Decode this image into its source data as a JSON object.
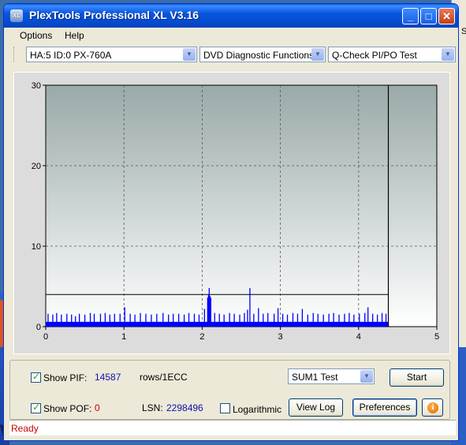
{
  "desktop": {
    "text": "ws",
    "side_label": "S"
  },
  "window": {
    "title": "PlexTools Professional XL V3.16",
    "icon_text": "XL",
    "minimize": "_",
    "maximize": "□",
    "close": "✕"
  },
  "menu": {
    "options": "Options",
    "help": "Help"
  },
  "toolbar": {
    "drive": "HA:5 ID:0  PX-760A",
    "function": "DVD Diagnostic Functions",
    "test": "Q-Check PI/PO Test",
    "dropdown_arrow": "▼"
  },
  "chart_data": {
    "type": "bar",
    "title": "",
    "xlabel": "",
    "ylabel": "",
    "xlim": [
      0,
      5
    ],
    "ylim": [
      0,
      30
    ],
    "x_ticks": [
      "0",
      "1",
      "2",
      "3",
      "4",
      "5"
    ],
    "y_ticks": [
      "0",
      "10",
      "20",
      "30"
    ],
    "grid": true,
    "threshold_line": 4,
    "end_marker_x": 4.38,
    "series": [
      {
        "color": "#0000ff",
        "baseline": 0.6,
        "data_end_x": 4.38,
        "spikes": [
          [
            0.03,
            1.6
          ],
          [
            0.09,
            1.5
          ],
          [
            0.14,
            1.7
          ],
          [
            0.2,
            1.5
          ],
          [
            0.27,
            1.6
          ],
          [
            0.33,
            1.5
          ],
          [
            0.38,
            1.3
          ],
          [
            0.43,
            1.6
          ],
          [
            0.5,
            1.5
          ],
          [
            0.57,
            1.7
          ],
          [
            0.62,
            1.6
          ],
          [
            0.7,
            1.6
          ],
          [
            0.76,
            1.7
          ],
          [
            0.82,
            1.5
          ],
          [
            0.88,
            1.6
          ],
          [
            0.95,
            1.6
          ],
          [
            1.01,
            2.4
          ],
          [
            1.08,
            1.6
          ],
          [
            1.14,
            1.5
          ],
          [
            1.21,
            1.7
          ],
          [
            1.28,
            1.6
          ],
          [
            1.35,
            1.5
          ],
          [
            1.42,
            1.6
          ],
          [
            1.5,
            1.7
          ],
          [
            1.57,
            1.5
          ],
          [
            1.63,
            1.6
          ],
          [
            1.7,
            1.6
          ],
          [
            1.77,
            1.5
          ],
          [
            1.83,
            1.7
          ],
          [
            1.9,
            1.6
          ],
          [
            1.96,
            1.5
          ],
          [
            2.03,
            2.2
          ],
          [
            2.07,
            3.6
          ],
          [
            2.08,
            3.9
          ],
          [
            2.09,
            4.8
          ],
          [
            2.1,
            3.8
          ],
          [
            2.11,
            3.6
          ],
          [
            2.16,
            1.7
          ],
          [
            2.22,
            1.6
          ],
          [
            2.28,
            1.5
          ],
          [
            2.35,
            1.7
          ],
          [
            2.41,
            1.6
          ],
          [
            2.48,
            1.5
          ],
          [
            2.54,
            1.7
          ],
          [
            2.58,
            2.1
          ],
          [
            2.61,
            4.8
          ],
          [
            2.66,
            1.6
          ],
          [
            2.72,
            2.3
          ],
          [
            2.78,
            1.6
          ],
          [
            2.84,
            1.7
          ],
          [
            2.92,
            1.6
          ],
          [
            2.97,
            2.3
          ],
          [
            3.03,
            1.6
          ],
          [
            3.09,
            1.5
          ],
          [
            3.16,
            1.7
          ],
          [
            3.22,
            1.6
          ],
          [
            3.28,
            2.2
          ],
          [
            3.35,
            1.5
          ],
          [
            3.42,
            1.7
          ],
          [
            3.48,
            1.6
          ],
          [
            3.55,
            1.5
          ],
          [
            3.62,
            1.6
          ],
          [
            3.68,
            1.7
          ],
          [
            3.75,
            1.5
          ],
          [
            3.82,
            1.6
          ],
          [
            3.88,
            1.7
          ],
          [
            3.94,
            1.5
          ],
          [
            4.01,
            1.6
          ],
          [
            4.08,
            1.7
          ],
          [
            4.12,
            2.4
          ],
          [
            4.18,
            1.6
          ],
          [
            4.24,
            1.5
          ],
          [
            4.3,
            1.7
          ],
          [
            4.35,
            1.6
          ]
        ]
      }
    ]
  },
  "controls": {
    "show_pif_label": "Show PIF:",
    "pif_value": "14587",
    "pif_unit": "rows/1ECC",
    "show_pof_label": "Show POF:",
    "pof_value": "0",
    "lsn_label": "LSN:",
    "lsn_value": "2298496",
    "logarithmic_label": "Logarithmic",
    "sum_test": "SUM1 Test",
    "start": "Start",
    "view_log": "View Log",
    "preferences": "Preferences",
    "info": "i",
    "check": "✓"
  },
  "status": {
    "text": "Ready"
  }
}
